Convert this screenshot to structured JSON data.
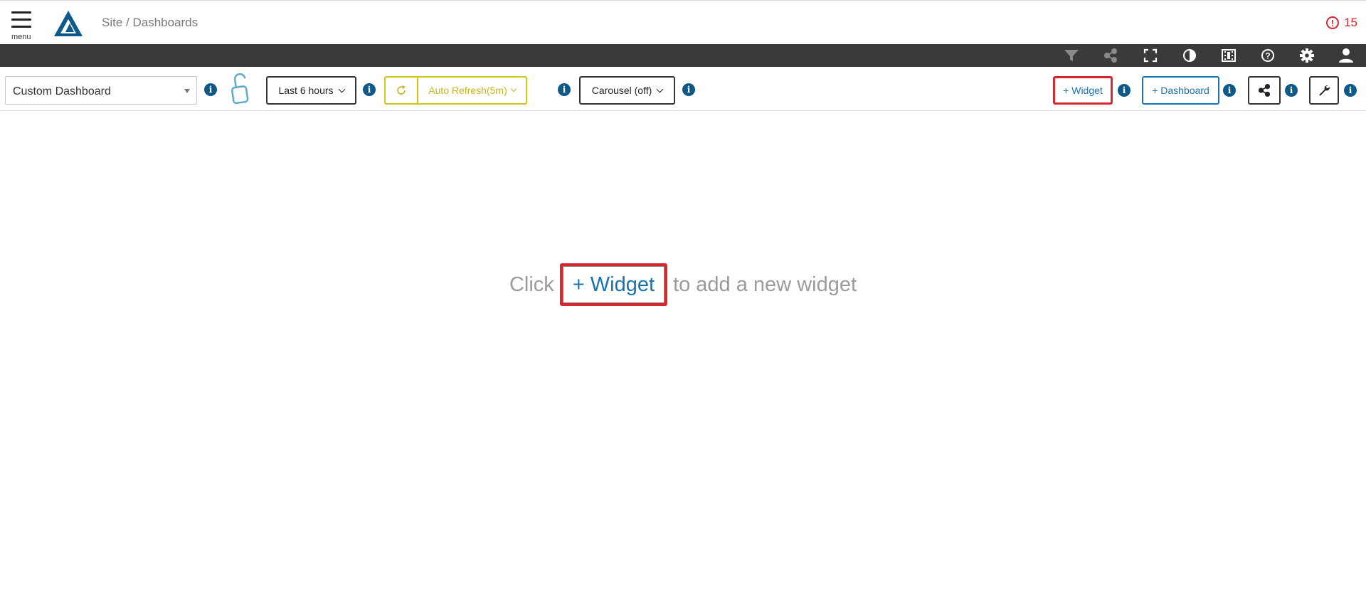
{
  "header": {
    "menu_label": "menu",
    "breadcrumb": "Site / Dashboards",
    "alert_count": "15",
    "alert_icon": "exclamation-circle-icon"
  },
  "toolbar_icons": [
    "filter-icon",
    "share-icon",
    "fullscreen-icon",
    "contrast-icon",
    "film-icon",
    "help-icon",
    "settings-icon",
    "user-icon"
  ],
  "controls": {
    "dashboard_select": "Custom Dashboard",
    "time_range": "Last 6 hours",
    "auto_refresh": "Auto Refresh(5m)",
    "carousel": "Carousel (off)",
    "add_widget": "+ Widget",
    "add_dashboard": "+ Dashboard",
    "info_glyph": "i"
  },
  "empty_state": {
    "prefix": "Click",
    "button": "+ Widget",
    "suffix": "to add a new widget"
  },
  "colors": {
    "accent_blue": "#1a73b0",
    "info_blue": "#0d5a8a",
    "alert_red": "#d8282f",
    "refresh_yellow": "#d4c31a",
    "toolbar_dark": "#3a3a3a"
  }
}
